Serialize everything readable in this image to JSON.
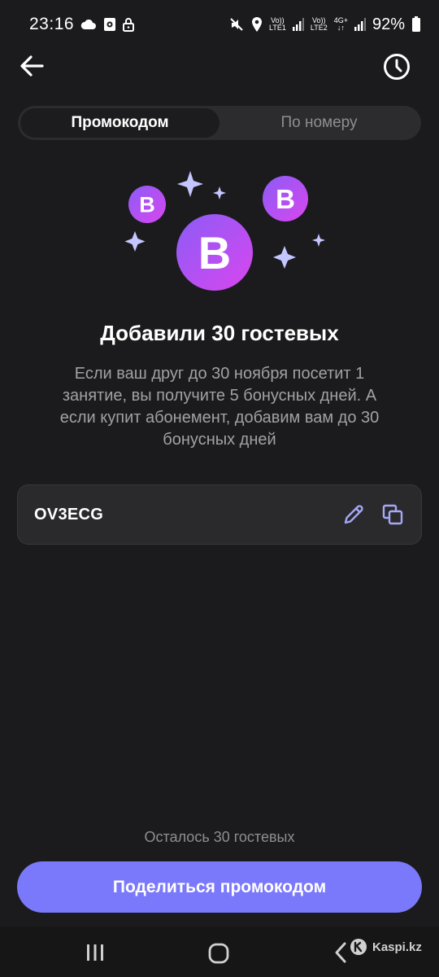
{
  "status_bar": {
    "time": "23:16",
    "volte1": "Vo))",
    "lte1": "LTE1",
    "volte2": "Vo))",
    "lte2": "LTE2",
    "network": "4G+",
    "battery": "92%",
    "icons": [
      "cloud-icon",
      "camera-icon",
      "lock-icon",
      "mute-icon",
      "location-icon",
      "signal-icon",
      "battery-icon"
    ]
  },
  "nav": {
    "back_icon": "arrow-left-icon",
    "history_icon": "clock-icon"
  },
  "tabs": [
    {
      "label": "Промокодом",
      "active": true
    },
    {
      "label": "По номеру",
      "active": false
    }
  ],
  "illustration": {
    "badge_letter": "B",
    "colors": {
      "badge_start": "#8b5cf6",
      "badge_end": "#d946ef",
      "sparkle": "#c4c6ff"
    }
  },
  "headline": "Добавили 30 гостевых",
  "description": "Если ваш друг до 30 ноября посетит 1 занятие, вы получите 5 бонусных дней. А если купит абонемент, добавим вам до 30 бонусных дней",
  "promo": {
    "code": "OV3ECG",
    "edit_icon": "pencil-icon",
    "copy_icon": "copy-icon"
  },
  "remaining": "Осталось 30 гостевых",
  "share_button": "Поделиться промокодом",
  "colors": {
    "background": "#1b1b1d",
    "accent": "#7b79fb",
    "field_bg": "#2a2a2d",
    "muted_text": "#a1a1a6"
  },
  "system_nav": {
    "recents_icon": "recents-icon",
    "home_icon": "home-icon",
    "back_icon": "chevron-left-icon"
  },
  "watermark": "Kaspi.kz"
}
